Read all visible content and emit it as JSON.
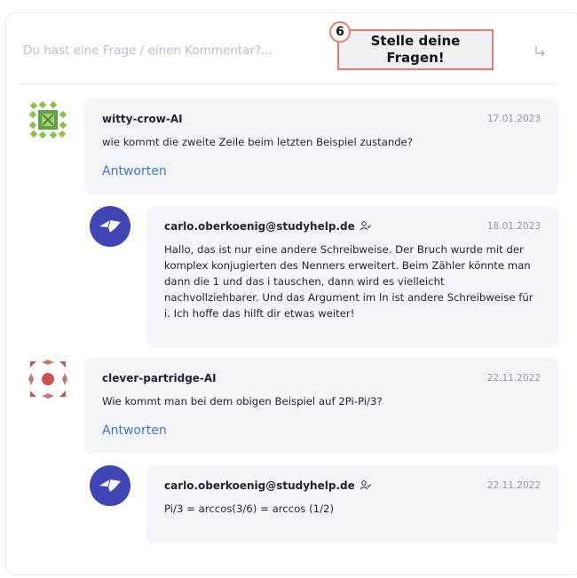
{
  "ask": {
    "placeholder": "Du hast eine Frage / einen Kommentar?...",
    "send_icon": "reply-arrow-icon"
  },
  "callout": {
    "number": "6",
    "text": "Stelle deine Fragen!"
  },
  "colors": {
    "accent_link": "#3f76d6",
    "callout_border": "#ee7b6a",
    "staff_avatar": "#3f45b5"
  },
  "comments": [
    {
      "author": "witty-crow-AI",
      "date": "17.01.2023",
      "text": "wie kommt die zweite Zeile beim letzten Beispiel zustande?",
      "reply_label": "Antworten",
      "avatar_icon": "identicon-green",
      "reply": {
        "author": "carlo.oberkoenig@studyhelp.de",
        "date": "18.01.2023",
        "text": "Hallo, das ist nur eine andere Schreibweise. Der Bruch wurde mit der komplex konjugierten des Nenners erweitert. Beim Zähler könnte man dann die 1 und das i tauschen, dann wird es vielleicht nachvollziehbarer. Und das Argument im ln ist andere Schreibweise für i. Ich hoffe das hilft dir etwas weiter!",
        "avatar_icon": "studyhelp-logo-icon"
      }
    },
    {
      "author": "clever-partridge-AI",
      "date": "22.11.2022",
      "text": "Wie kommt man bei dem obigen Beispiel auf 2Pi-Pi/3?",
      "reply_label": "Antworten",
      "avatar_icon": "identicon-red",
      "reply": {
        "author": "carlo.oberkoenig@studyhelp.de",
        "date": "22.11.2022",
        "text": "Pi/3 = arccos(3/6) = arccos (1/2)",
        "avatar_icon": "studyhelp-logo-icon"
      }
    }
  ]
}
